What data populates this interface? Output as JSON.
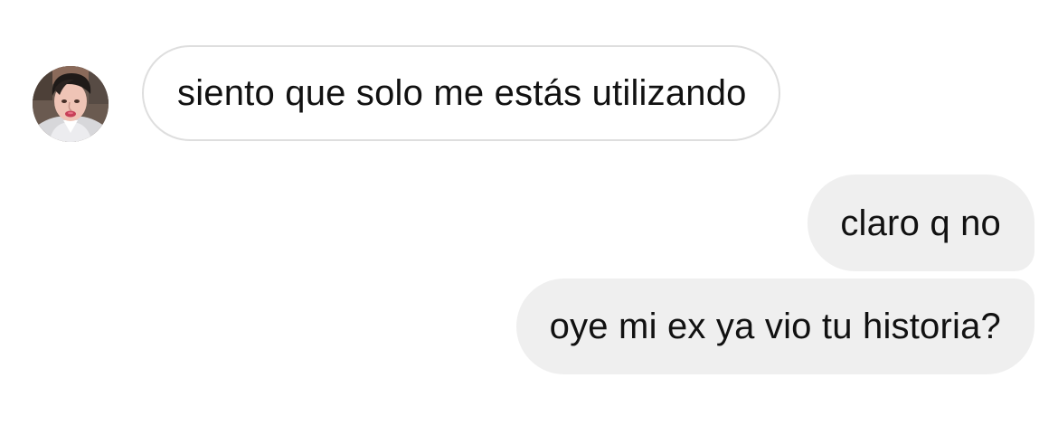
{
  "conversation": {
    "messages": [
      {
        "sender": "other",
        "text": "siento que solo me estás utilizando"
      },
      {
        "sender": "me",
        "text": "claro q no"
      },
      {
        "sender": "me",
        "text": "oye mi ex ya vio tu historia?"
      }
    ]
  },
  "colors": {
    "page_background": "#ffffff",
    "incoming_bubble_border": "#dedede",
    "outgoing_bubble_background": "#efefef",
    "text": "#111111"
  },
  "icons": {
    "avatar": "user-avatar-photo"
  }
}
